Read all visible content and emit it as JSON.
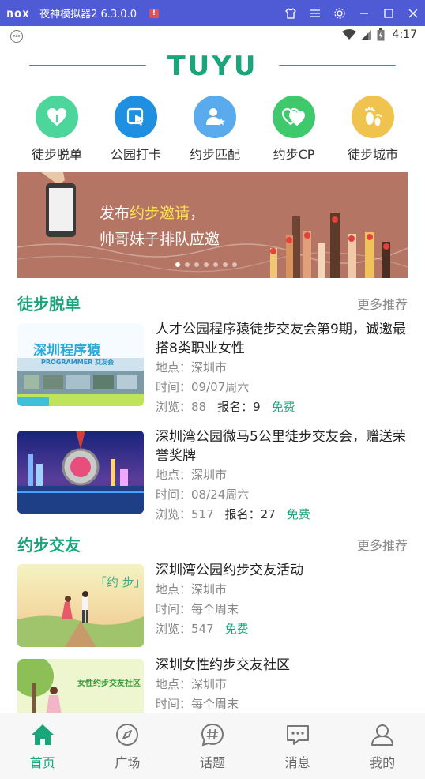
{
  "emulator": {
    "logo": "nox",
    "title": "夜神模拟器2 6.3.0.0",
    "flag": "!"
  },
  "status_bar": {
    "time": "4:17",
    "mini_logo": "nox"
  },
  "brand": {
    "title": "TUYU"
  },
  "categories": [
    {
      "label": "徒步脱单",
      "icon": "heart-drop-icon",
      "color": "#4dd69b"
    },
    {
      "label": "公园打卡",
      "icon": "checkin-cursor-icon",
      "color": "#1e8fe1"
    },
    {
      "label": "约步匹配",
      "icon": "person-star-icon",
      "color": "#5aaaee"
    },
    {
      "label": "约步CP",
      "icon": "double-heart-icon",
      "color": "#3fc96d"
    },
    {
      "label": "徒步城市",
      "icon": "footprints-icon",
      "color": "#f0c24e"
    }
  ],
  "banner": {
    "line1_pre": "发布",
    "line1_highlight": "约步邀请",
    "line1_post": "，",
    "line2": "帅哥妹子排队应邀",
    "dots_total": 7,
    "dots_active": 1
  },
  "sections": [
    {
      "title": "徒步脱单",
      "more": "更多推荐",
      "items": [
        {
          "title": "人才公园程序猿徒步交友会第9期，诚邀最搭8类职业女性",
          "location_label": "地点：",
          "location": "深圳市",
          "time_label": "时间：",
          "time": "09/07周六",
          "views_label": "浏览：",
          "views": "88",
          "signup_label": "报名：",
          "signup": "9",
          "price": "免费",
          "thumb_text_1": "深圳程序猿",
          "thumb_text_2": "PROGRAMMER 交友会"
        },
        {
          "title": "深圳湾公园微马5公里徒步交友会，赠送荣誉奖牌",
          "location_label": "地点：",
          "location": "深圳市",
          "time_label": "时间：",
          "time": "08/24周六",
          "views_label": "浏览：",
          "views": "517",
          "signup_label": "报名：",
          "signup": "27",
          "price": "免费"
        }
      ]
    },
    {
      "title": "约步交友",
      "more": "更多推荐",
      "items": [
        {
          "title": "深圳湾公园约步交友活动",
          "location_label": "地点：",
          "location": "深圳市",
          "time_label": "时间：",
          "time": "每个周末",
          "views_label": "浏览：",
          "views": "547",
          "price": "免费",
          "thumb_text_1": "「约 步」"
        },
        {
          "title": "深圳女性约步交友社区",
          "location_label": "地点：",
          "location": "深圳市",
          "time_label": "时间：",
          "time": "每个周末",
          "thumb_text_1": "女性约步交友社区"
        }
      ]
    }
  ],
  "bottom_nav": [
    {
      "label": "首页",
      "icon": "home-icon",
      "active": true
    },
    {
      "label": "广场",
      "icon": "compass-icon",
      "active": false
    },
    {
      "label": "话题",
      "icon": "hashtag-bubble-icon",
      "active": false
    },
    {
      "label": "消息",
      "icon": "message-icon",
      "active": false
    },
    {
      "label": "我的",
      "icon": "user-icon",
      "active": false
    }
  ],
  "colors": {
    "accent": "#1aa57a",
    "emulator_bar": "#4f5bd5"
  }
}
